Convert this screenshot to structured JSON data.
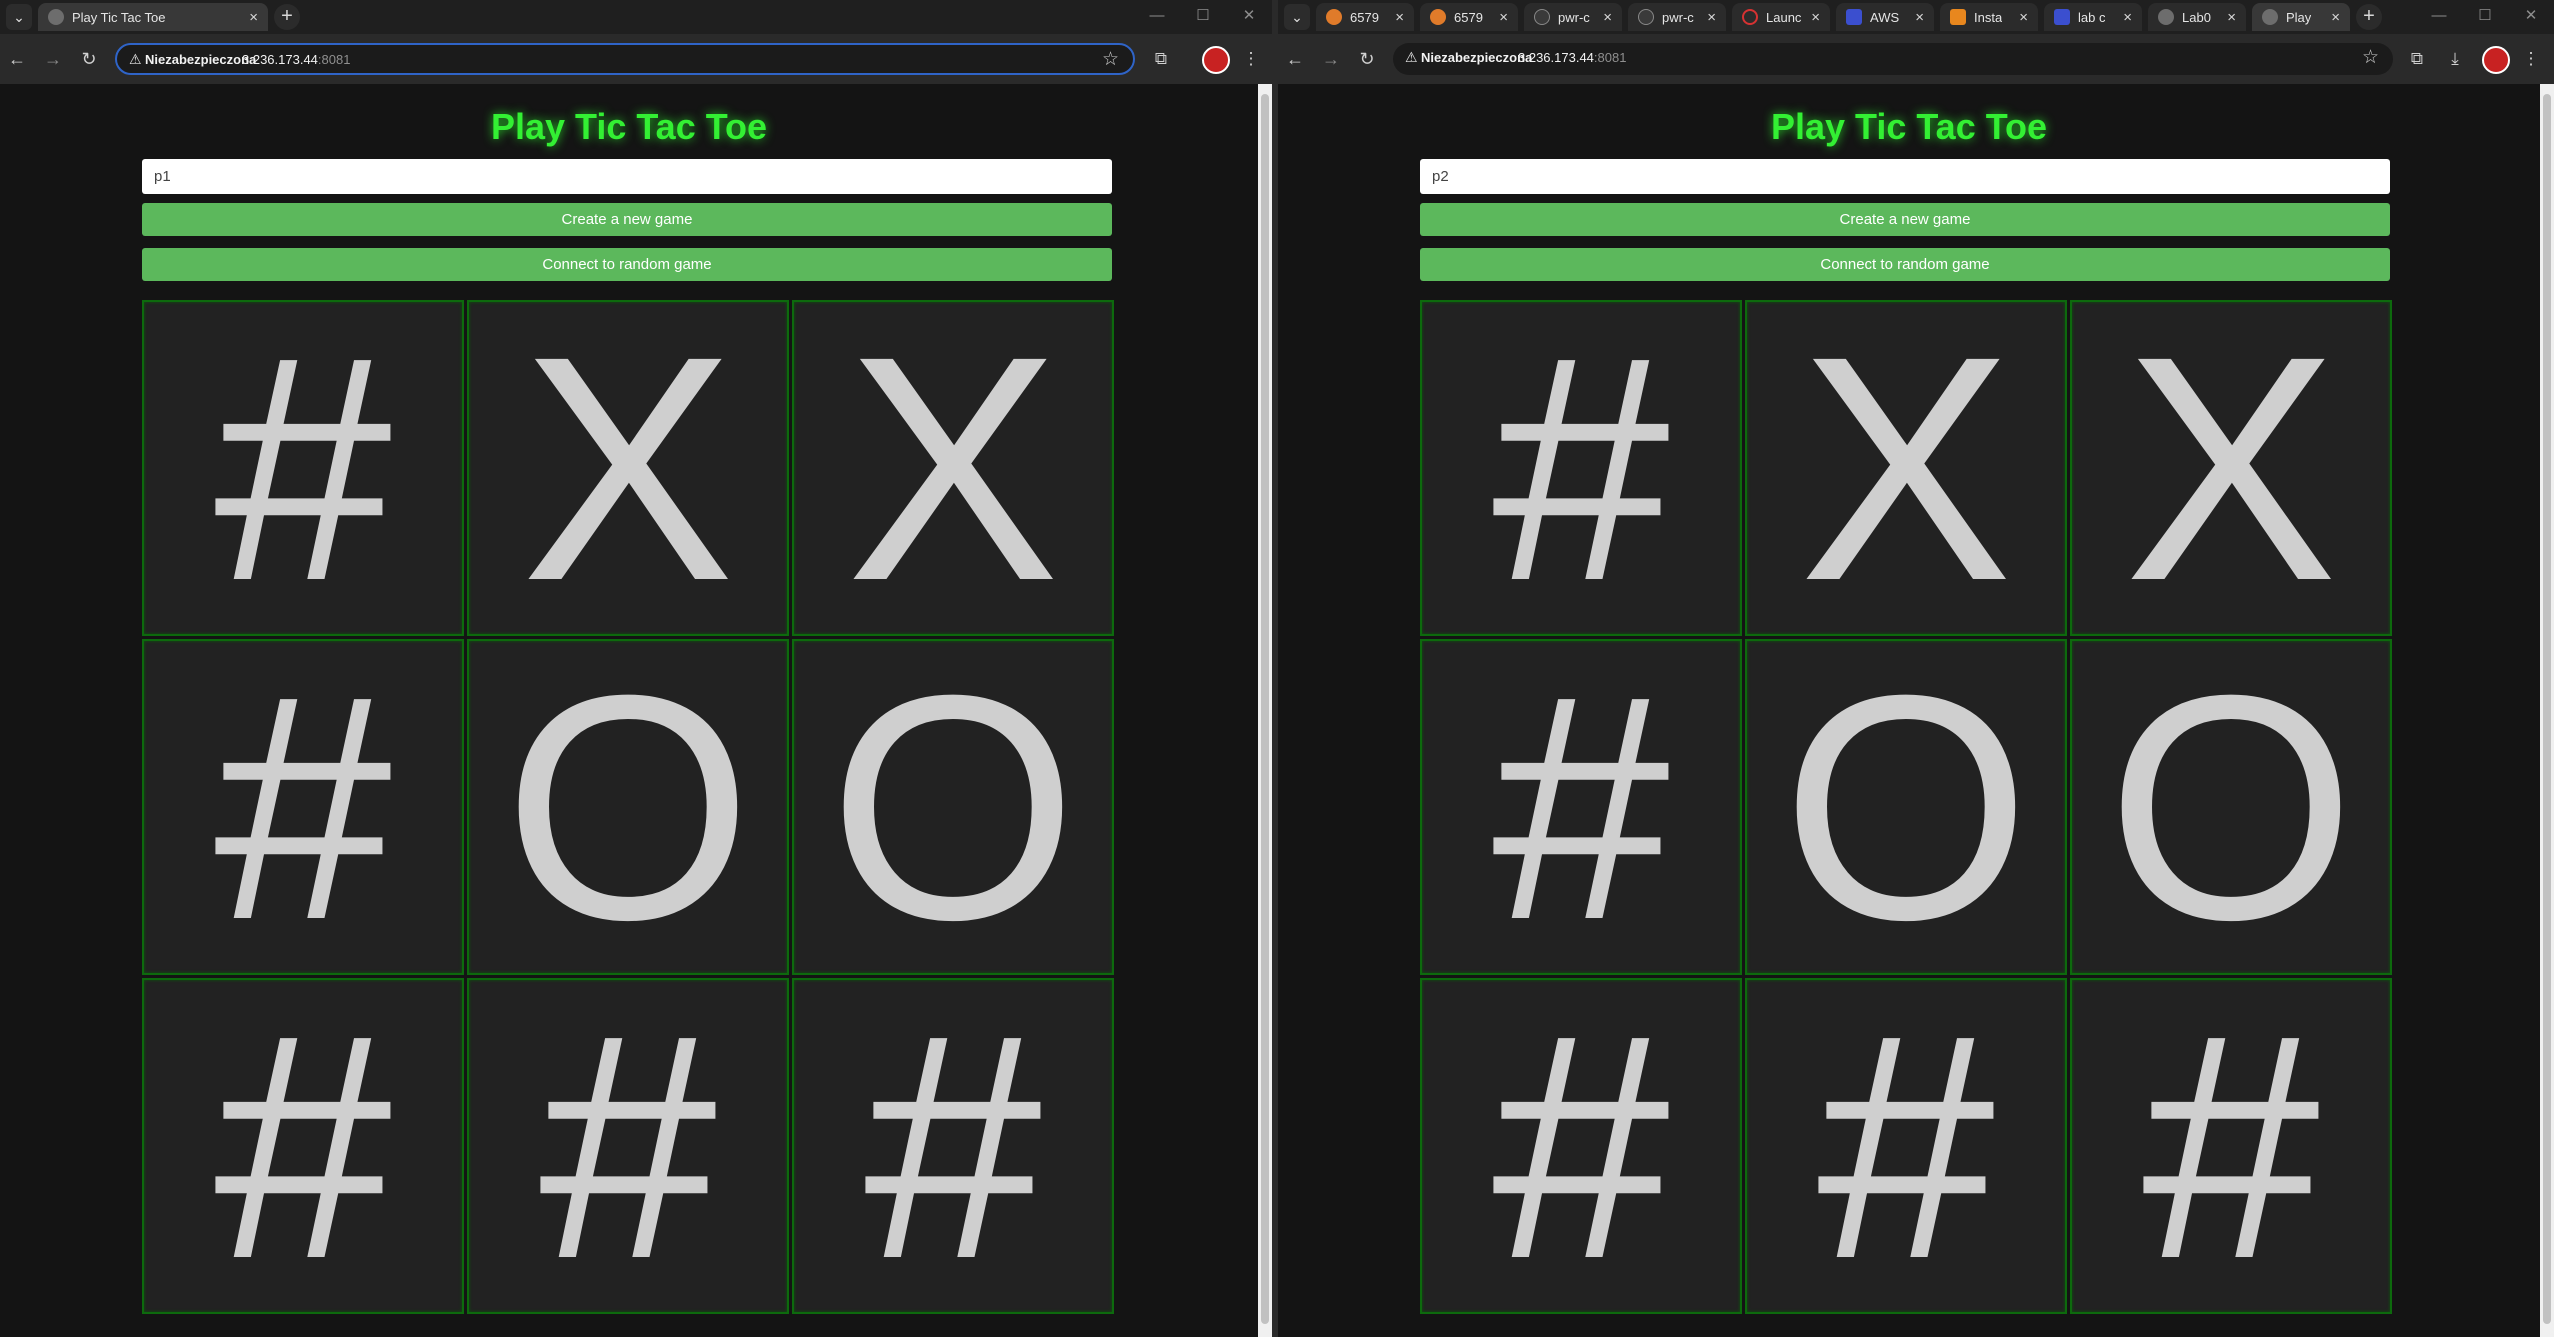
{
  "left_window": {
    "tabs": [
      {
        "title": "Play Tic Tac Toe",
        "close": "×"
      }
    ],
    "new_tab": "+",
    "window_controls": {
      "minimize": "—",
      "maximize": "☐",
      "close": "✕"
    },
    "toolbar": {
      "back": "←",
      "forward": "→",
      "reload": "↻",
      "security_icon": "⚠",
      "security_label": "Niezabezpieczona",
      "url_host": "3.236.173.44",
      "url_port": ":8081",
      "bookmark": "☆",
      "extensions": "⧉",
      "menu": "⋮"
    },
    "page": {
      "heading": "Play Tic Tac Toe",
      "name_input_value": "p1",
      "create_button": "Create a new game",
      "connect_button": "Connect to random game",
      "board": [
        "#",
        "X",
        "X",
        "#",
        "O",
        "O",
        "#",
        "#",
        "#"
      ]
    }
  },
  "right_window": {
    "tabs": [
      {
        "title": "6579",
        "close": "×",
        "favicon_color": "#e07b2a"
      },
      {
        "title": "6579",
        "close": "×",
        "favicon_color": "#e07b2a"
      },
      {
        "title": "pwr-c",
        "close": "×",
        "favicon_color": "#3a3a3a"
      },
      {
        "title": "pwr-c",
        "close": "×",
        "favicon_color": "#3a3a3a"
      },
      {
        "title": "Launc",
        "close": "×",
        "favicon_color": "#d63232"
      },
      {
        "title": "AWS",
        "close": "×",
        "favicon_color": "#3b4fcf"
      },
      {
        "title": "Insta",
        "close": "×",
        "favicon_color": "#e8871e"
      },
      {
        "title": "lab c",
        "close": "×",
        "favicon_color": "#3b4fcf"
      },
      {
        "title": "Lab0",
        "close": "×",
        "favicon_color": "#6b6b6b"
      },
      {
        "title": "Play",
        "close": "×",
        "favicon_color": "#6b6b6b"
      }
    ],
    "new_tab": "+",
    "window_controls": {
      "minimize": "—",
      "maximize": "☐",
      "close": "✕"
    },
    "toolbar": {
      "back": "←",
      "forward": "→",
      "reload": "↻",
      "security_icon": "⚠",
      "security_label": "Niezabezpieczona",
      "url_host": "3.236.173.44",
      "url_port": ":8081",
      "bookmark": "☆",
      "extensions": "⧉",
      "download": "⤓",
      "menu": "⋮"
    },
    "page": {
      "heading": "Play Tic Tac Toe",
      "name_input_value": "p2",
      "create_button": "Create a new game",
      "connect_button": "Connect to random game",
      "board": [
        "#",
        "X",
        "X",
        "#",
        "O",
        "O",
        "#",
        "#",
        "#"
      ]
    }
  }
}
